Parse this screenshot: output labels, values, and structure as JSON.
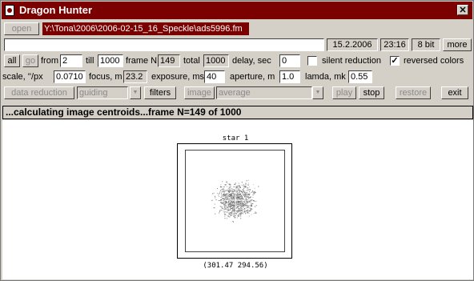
{
  "window": {
    "title": "Dragon Hunter",
    "close_glyph": "✕"
  },
  "row1": {
    "open_label": "open",
    "path": "Y:\\Tona\\2006\\2006-02-15_16_Speckle\\ads5996.fm"
  },
  "row2": {
    "date": "15.2.2006",
    "time": "23:16",
    "bits": "8 bit",
    "more_label": "more"
  },
  "row3": {
    "all_label": "all",
    "go_label": "go",
    "from_label": "from",
    "from_value": "2",
    "till_label": "till",
    "till_value": "1000",
    "frame_label": "frame N",
    "frame_value": "149",
    "total_label": "total",
    "total_value": "1000",
    "delay_label": "delay, sec",
    "delay_value": "0",
    "silent_label": "silent reduction",
    "silent_checked": false,
    "reversed_label": "reversed colors",
    "reversed_checked": true
  },
  "row4": {
    "scale_label": "scale, ''/px",
    "scale_value": "0.0710",
    "focus_label": "focus, m",
    "focus_value": "23.2",
    "exposure_label": "exposure, ms",
    "exposure_value": "40",
    "aperture_label": "aperture, m",
    "aperture_value": "1.0",
    "lamda_label": "lamda, mk",
    "lamda_value": "0.55"
  },
  "row5": {
    "data_reduction_label": "data reduction",
    "guiding_value": "guiding",
    "filters_label": "filters",
    "image_label": "image",
    "average_value": "average",
    "play_label": "play",
    "stop_label": "stop",
    "restore_label": "restore",
    "exit_label": "exit"
  },
  "status": "...calculating image centroids...frame N=149 of  1000",
  "plot": {
    "title": "star 1",
    "coords": "(301.47   294.56)"
  },
  "colors": {
    "titlebar": "#7b0000",
    "path_bg": "#7b0000",
    "panel": "#d4d0c8"
  },
  "icons": [
    "dragon-app-icon",
    "close-icon",
    "checkbox-checked-icon",
    "dropdown-arrow-icon"
  ]
}
